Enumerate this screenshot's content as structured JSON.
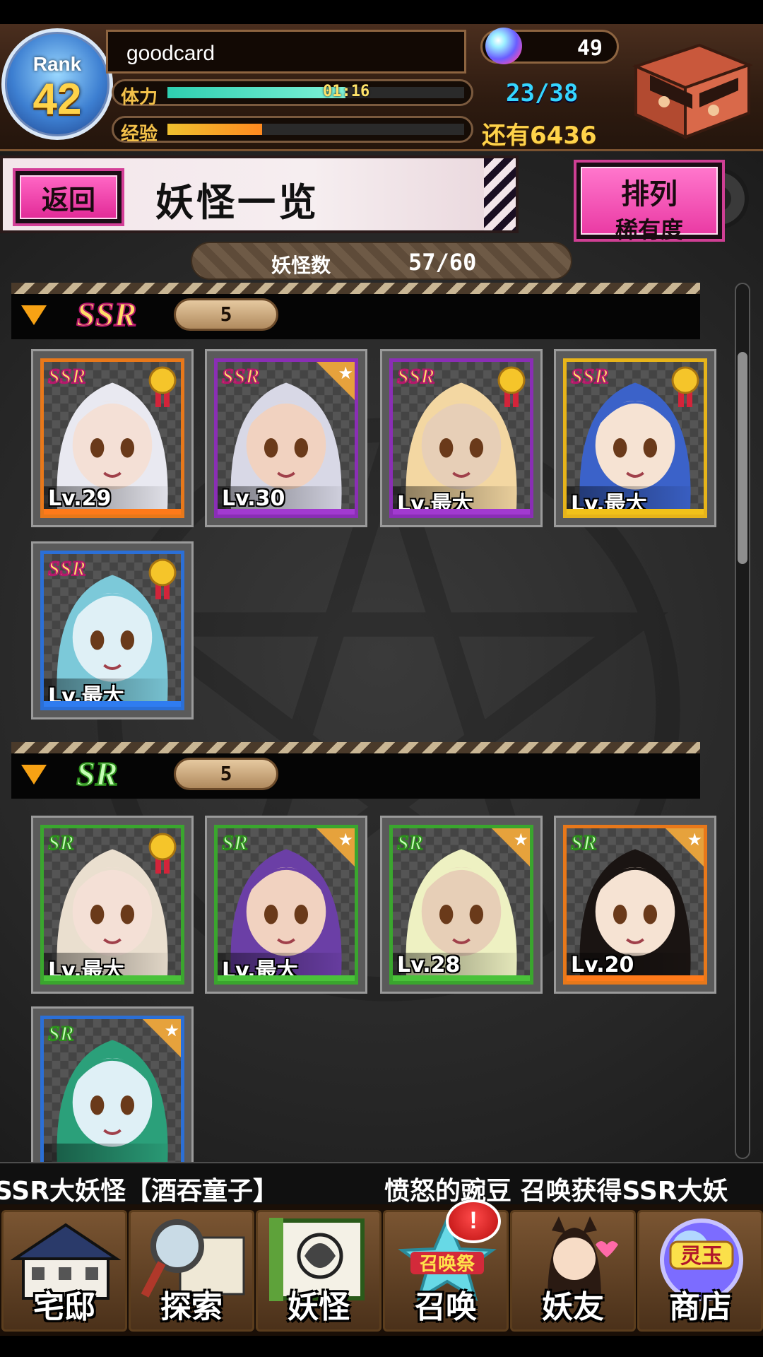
{
  "player": {
    "rank_label": "Rank",
    "rank": "42",
    "name": "goodcard",
    "stamina_label": "体力",
    "stamina_timer": "01:16",
    "stamina_text": "23/38",
    "stamina_fraction": 0.6,
    "exp_label": "经验",
    "exp_fraction": 0.32,
    "remaining_text": "还有6436",
    "orbs": "49"
  },
  "title_bar": {
    "back_label": "返回",
    "title": "妖怪一览",
    "sort_title": "排列",
    "sort_value": "稀有度"
  },
  "summary": {
    "label": "妖怪数",
    "value": "57/60"
  },
  "sections": [
    {
      "rarity": "SSR",
      "count": "5",
      "cards": [
        {
          "tag": "SSR",
          "level": "Lv.29",
          "medal": true,
          "frame": "#e8781a",
          "bar": "#ff7a1a"
        },
        {
          "tag": "SSR",
          "level": "Lv.30",
          "medal": false,
          "frame": "#8a2eb5",
          "bar": "#a23ad0"
        },
        {
          "tag": "SSR",
          "level": "Lv.最大",
          "medal": true,
          "frame": "#8a2eb5",
          "bar": "#a23ad0"
        },
        {
          "tag": "SSR",
          "level": "Lv.最大",
          "medal": true,
          "frame": "#e7b41a",
          "bar": "#f2c21a"
        },
        {
          "tag": "SSR",
          "level": "Lv.最大",
          "medal": true,
          "frame": "#2b6fd6",
          "bar": "#2f7cf0"
        }
      ]
    },
    {
      "rarity": "SR",
      "count": "5",
      "cards": [
        {
          "tag": "SR",
          "level": "Lv.最大",
          "medal": true,
          "frame": "#3aa62e",
          "bar": "#4ac23a"
        },
        {
          "tag": "SR",
          "level": "Lv.最大",
          "medal": false,
          "frame": "#3aa62e",
          "bar": "#4ac23a"
        },
        {
          "tag": "SR",
          "level": "Lv.28",
          "medal": false,
          "frame": "#3aa62e",
          "bar": "#4ac23a"
        },
        {
          "tag": "SR",
          "level": "Lv.20",
          "medal": false,
          "frame": "#e8781a",
          "bar": "#ff7a1a"
        },
        {
          "tag": "SR",
          "level": "",
          "medal": false,
          "frame": "#2b6fd6",
          "bar": "#2f7cf0"
        }
      ]
    }
  ],
  "ticker": {
    "left_text": "得SSR大妖怪【酒吞童子】",
    "right_text": "愤怒的豌豆 召唤获得SSR大妖"
  },
  "nav": [
    {
      "label": "宅邸",
      "icon": "mansion-icon"
    },
    {
      "label": "探索",
      "icon": "magnifier-map-icon"
    },
    {
      "label": "妖怪",
      "icon": "scroll-icon"
    },
    {
      "label": "召唤",
      "icon": "summon-festival-icon",
      "badge": "!",
      "banner": "召唤祭"
    },
    {
      "label": "妖友",
      "icon": "friend-girl-icon"
    },
    {
      "label": "商店",
      "icon": "spirit-orb-icon",
      "banner": "灵玉"
    }
  ]
}
